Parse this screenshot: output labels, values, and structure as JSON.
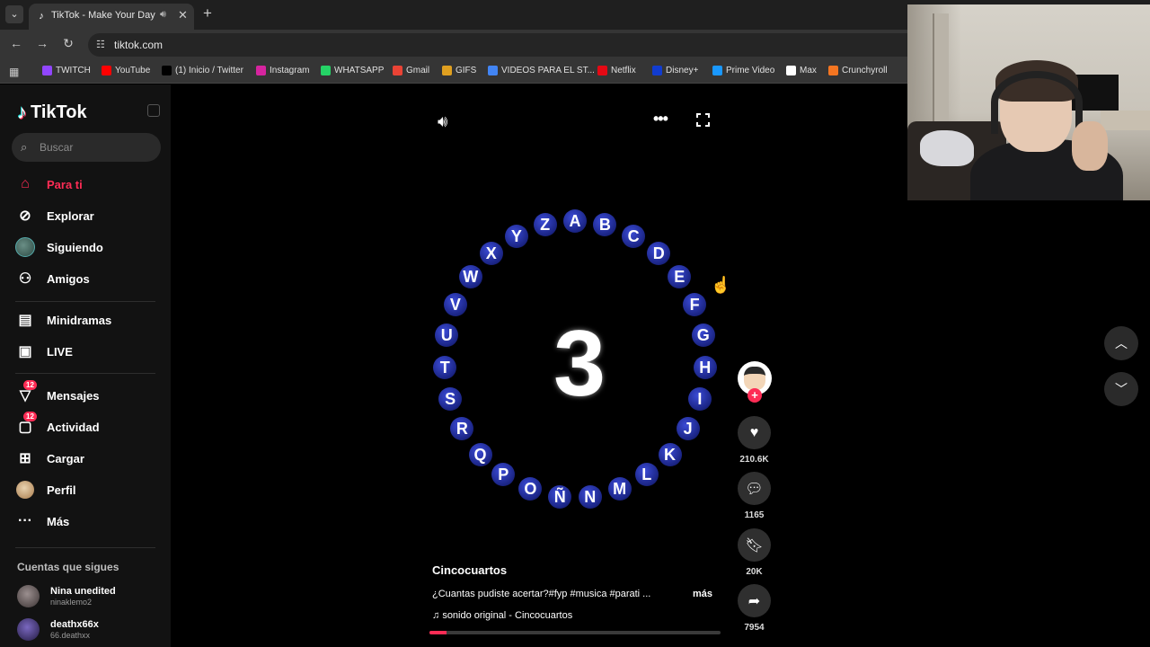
{
  "browser": {
    "tab_title": "TikTok - Make Your Day",
    "url": "tiktok.com",
    "bookmarks": [
      {
        "label": "TWITCH",
        "icon": "twitch-icon",
        "color": "#9146ff"
      },
      {
        "label": "YouTube",
        "icon": "youtube-icon",
        "color": "#ff0000"
      },
      {
        "label": "(1) Inicio / Twitter",
        "icon": "x-icon",
        "color": "#000000"
      },
      {
        "label": "Instagram",
        "icon": "instagram-icon",
        "color": "#d6249f"
      },
      {
        "label": "WHATSAPP",
        "icon": "whatsapp-icon",
        "color": "#25d366"
      },
      {
        "label": "Gmail",
        "icon": "gmail-icon",
        "color": "#ea4335"
      },
      {
        "label": "GIFS",
        "icon": "gifs-icon",
        "color": "#e0a020"
      },
      {
        "label": "VIDEOS PARA EL ST...",
        "icon": "drive-icon",
        "color": "#4285f4"
      },
      {
        "label": "Netflix",
        "icon": "netflix-icon",
        "color": "#e50914"
      },
      {
        "label": "Disney+",
        "icon": "disney-icon",
        "color": "#113ccf"
      },
      {
        "label": "Prime Video",
        "icon": "prime-icon",
        "color": "#1a98ff"
      },
      {
        "label": "Max",
        "icon": "max-icon",
        "color": "#ffffff"
      },
      {
        "label": "Crunchyroll",
        "icon": "crunchyroll-icon",
        "color": "#f47521"
      }
    ]
  },
  "sidebar": {
    "logo_text": "TikTok",
    "search_placeholder": "Buscar",
    "items": [
      {
        "label": "Para ti",
        "icon": "home-icon",
        "active": true
      },
      {
        "label": "Explorar",
        "icon": "compass-icon"
      },
      {
        "label": "Siguiendo",
        "icon": "following-avatar-icon"
      },
      {
        "label": "Amigos",
        "icon": "friends-icon"
      },
      {
        "label": "Minidramas",
        "icon": "film-icon"
      },
      {
        "label": "LIVE",
        "icon": "live-icon"
      },
      {
        "label": "Mensajes",
        "icon": "messages-icon",
        "badge": "12"
      },
      {
        "label": "Actividad",
        "icon": "activity-icon",
        "badge": "12"
      },
      {
        "label": "Cargar",
        "icon": "upload-icon"
      },
      {
        "label": "Perfil",
        "icon": "profile-avatar-icon"
      },
      {
        "label": "Más",
        "icon": "more-dots-icon"
      }
    ],
    "following_title": "Cuentas que sigues",
    "accounts": [
      {
        "name": "Nina unedited",
        "handle": "ninaklemo2"
      },
      {
        "name": "deathx66x",
        "handle": "66.deathxx"
      }
    ]
  },
  "video": {
    "letters": [
      "A",
      "B",
      "C",
      "D",
      "E",
      "F",
      "G",
      "H",
      "I",
      "J",
      "K",
      "L",
      "M",
      "N",
      "Ñ",
      "O",
      "P",
      "Q",
      "R",
      "S",
      "T",
      "U",
      "V",
      "W",
      "X",
      "Y",
      "Z"
    ],
    "center_number": "3",
    "author": "Cincocuartos",
    "description": "¿Cuantas pudiste acertar?#fyp #musica #parati ...",
    "more_label": "más",
    "music": "sonido original - Cincocuartos",
    "progress": 0.06
  },
  "actions": {
    "likes": "210.6K",
    "comments": "1165",
    "saves": "20K",
    "shares": "7954"
  }
}
